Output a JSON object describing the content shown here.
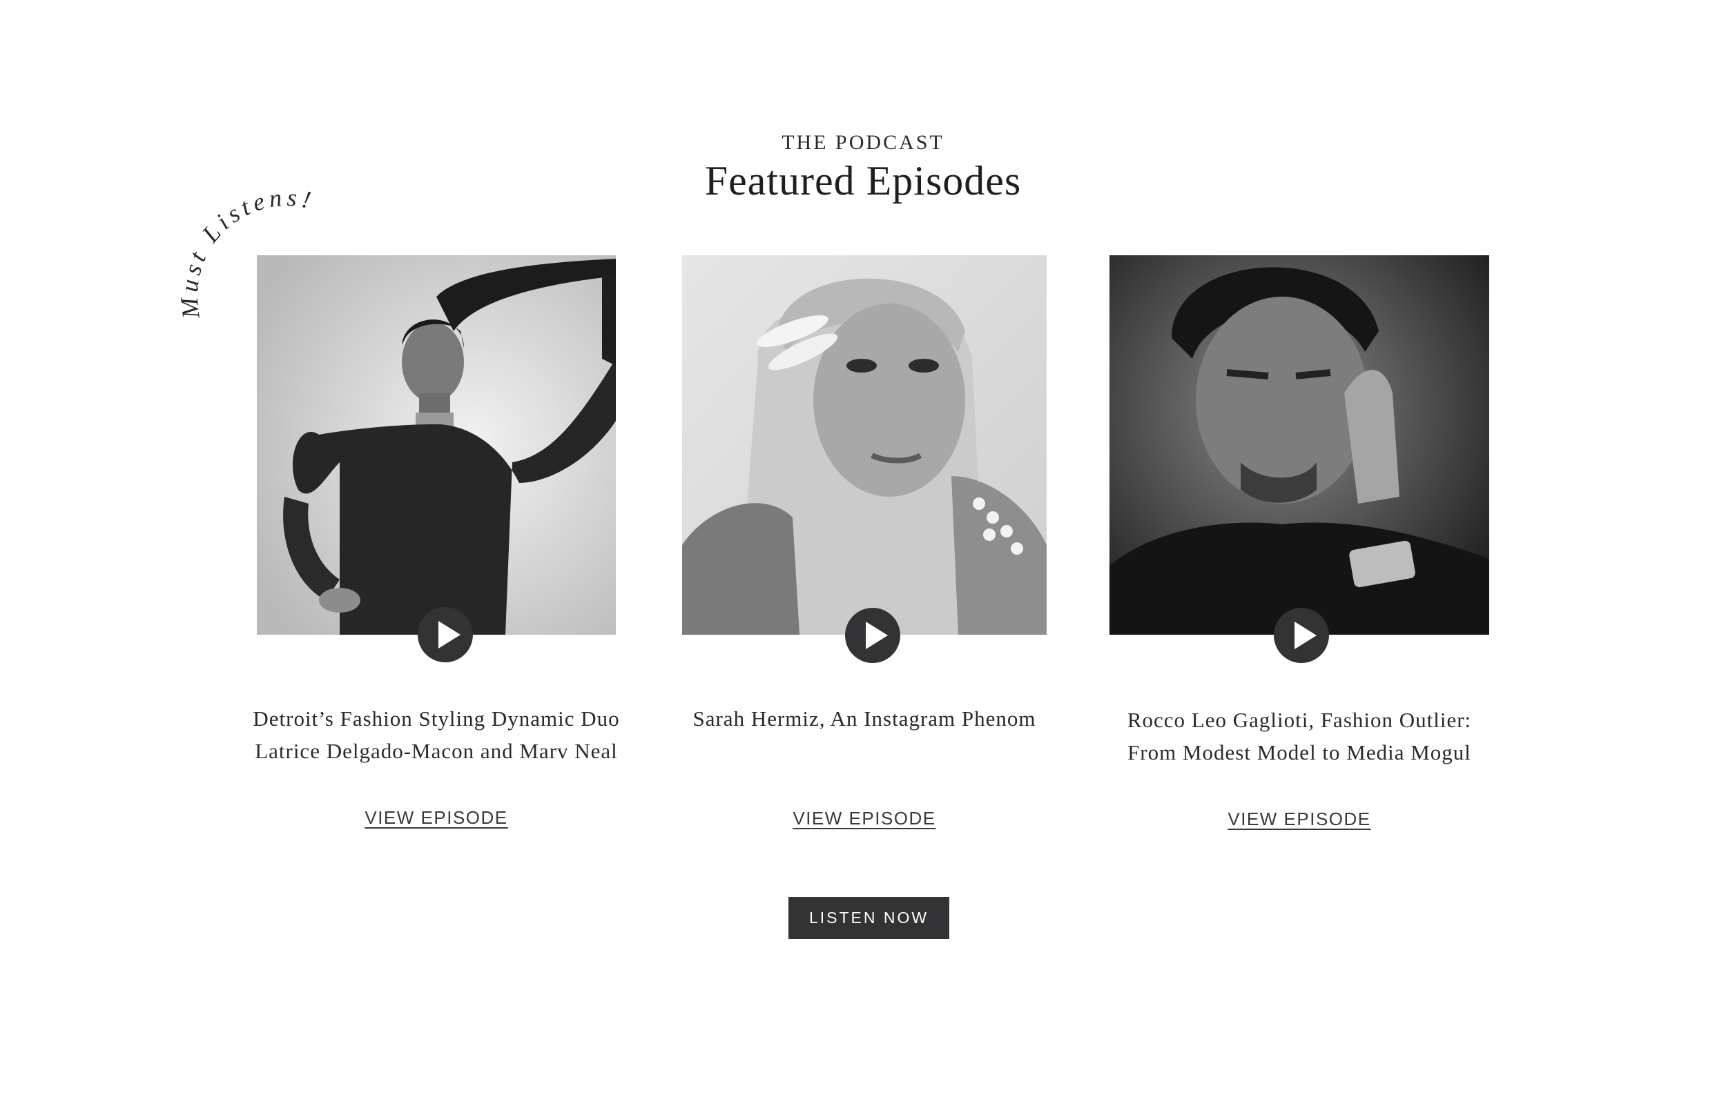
{
  "header": {
    "eyebrow": "THE PODCAST",
    "title": "Featured Episodes",
    "badge_text": "Must Listens!"
  },
  "episodes": [
    {
      "title_line1": "Detroit’s Fashion Styling Dynamic Duo",
      "title_line2": "Latrice Delgado-Macon and Marv Neal",
      "link_label": "VIEW EPISODE",
      "photo_icon": "portrait-photo-woman-ponytail",
      "play_icon": "play-icon"
    },
    {
      "title_line1": "Sarah Hermiz, An Instagram Phenom",
      "title_line2": "",
      "link_label": "VIEW EPISODE",
      "photo_icon": "portrait-photo-woman-pearl-clips",
      "play_icon": "play-icon"
    },
    {
      "title_line1": "Rocco Leo Gaglioti, Fashion Outlier:",
      "title_line2": "From Modest Model to Media Mogul",
      "link_label": "VIEW EPISODE",
      "photo_icon": "portrait-photo-man",
      "play_icon": "play-icon"
    }
  ],
  "cta": {
    "label": "LISTEN NOW"
  },
  "colors": {
    "text": "#2a2a2c",
    "button_bg": "#333335",
    "background": "#ffffff"
  }
}
